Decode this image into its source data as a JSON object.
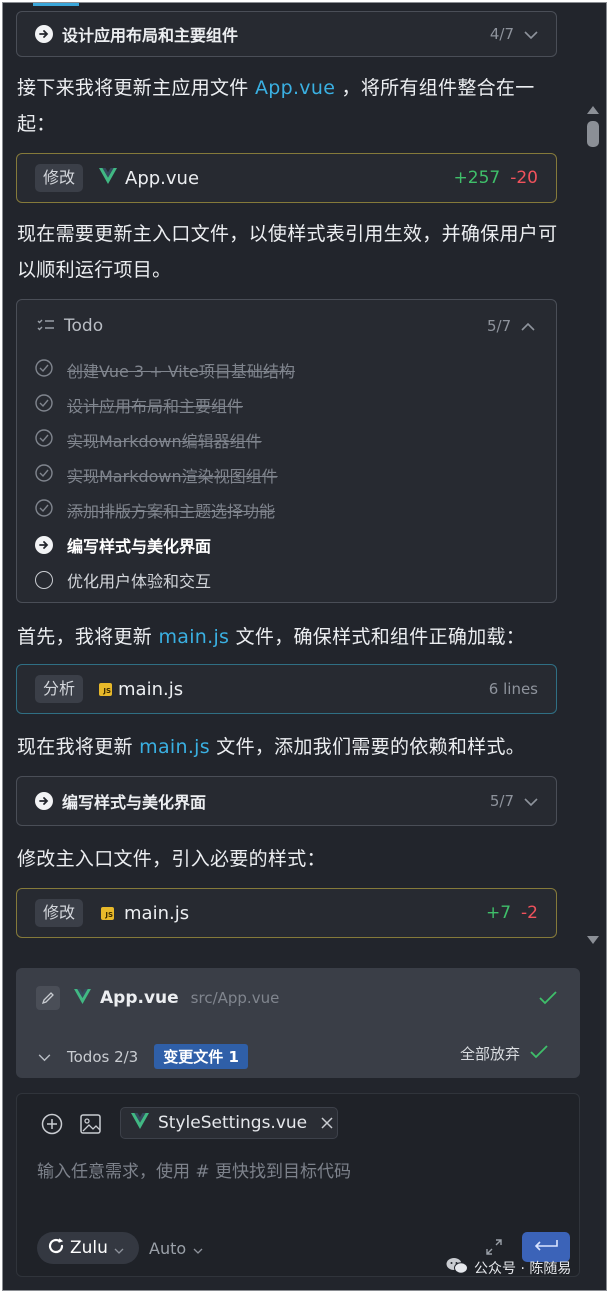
{
  "steps": {
    "step1": {
      "title": "设计应用布局和主要组件",
      "count": "4/7"
    },
    "step2": {
      "title": "编写样式与美化界面",
      "count": "5/7"
    }
  },
  "paragraphs": {
    "p1_pre": "接下来我将更新主应用文件 ",
    "p1_link": "App.vue",
    "p1_post": " ，将所有组件整合在一起：",
    "p2": "现在需要更新主入口文件，以使样式表引用生效，并确保用户可以顺利运行项目。",
    "p3_pre": "首先，我将更新 ",
    "p3_link": "main.js",
    "p3_post": " 文件，确保样式和组件正确加载：",
    "p4_pre": "现在我将更新 ",
    "p4_link": "main.js",
    "p4_post": " 文件，添加我们需要的依赖和样式。",
    "p5": "修改主入口文件，引入必要的样式："
  },
  "file_cards": {
    "app_vue": {
      "tag": "修改",
      "file": "App.vue",
      "added": "+257",
      "removed": "-20"
    },
    "main_js_analyze": {
      "tag": "分析",
      "file": "main.js",
      "lines": "6 lines"
    },
    "main_js_edit": {
      "tag": "修改",
      "file": "main.js",
      "added": "+7",
      "removed": "-2"
    }
  },
  "todo": {
    "title": "Todo",
    "count": "5/7",
    "items": [
      {
        "label": "创建Vue 3 + Vite项目基础结构",
        "status": "done"
      },
      {
        "label": "设计应用布局和主要组件",
        "status": "done"
      },
      {
        "label": "实现Markdown编辑器组件",
        "status": "done"
      },
      {
        "label": "实现Markdown渲染视图组件",
        "status": "done"
      },
      {
        "label": "添加排版方案和主题选择功能",
        "status": "done"
      },
      {
        "label": "编写样式与美化界面",
        "status": "active"
      },
      {
        "label": "优化用户体验和交互",
        "status": "pending"
      }
    ]
  },
  "review_panel": {
    "file": "App.vue",
    "path": "src/App.vue",
    "todos": "Todos 2/3",
    "changed_files": "变更文件 1",
    "discard_all": "全部放弃"
  },
  "composer": {
    "attached_file": "StyleSettings.vue",
    "placeholder": "输入任意需求，使用 # 更快找到目标代码",
    "model": "Zulu",
    "mode": "Auto"
  },
  "watermark": {
    "text": "公众号 · 陈随易"
  },
  "colors": {
    "accent": "#3ab0e2",
    "added": "#3fbf6a",
    "removed": "#f0525c",
    "vue": "#41b883",
    "send": "#3b63b8"
  }
}
